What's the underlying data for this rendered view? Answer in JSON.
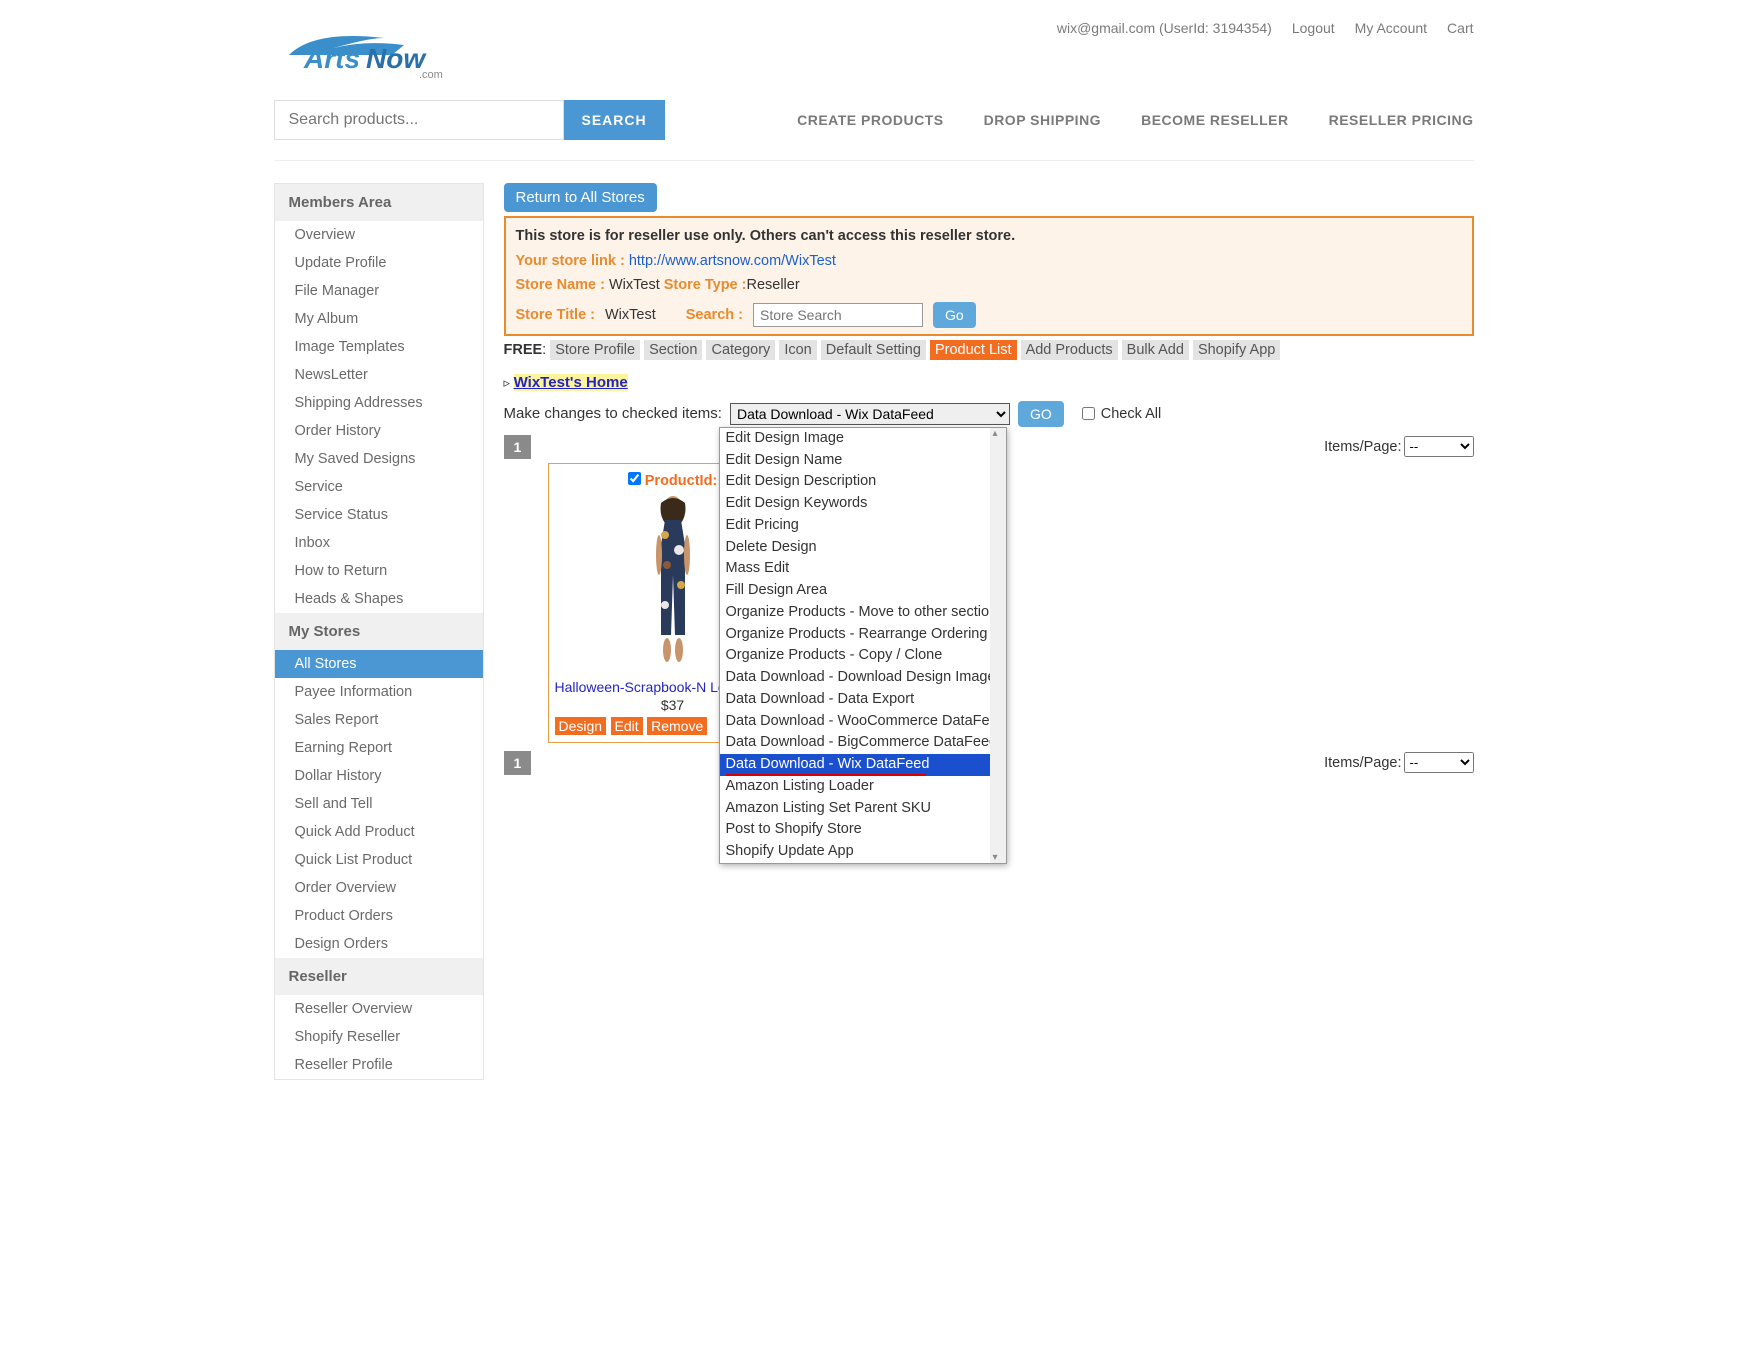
{
  "top": {
    "userinfo": "wix@gmail.com (UserId: 3194354)",
    "logout": "Logout",
    "myaccount": "My Account",
    "cart": "Cart"
  },
  "search": {
    "placeholder": "Search products...",
    "button": "SEARCH"
  },
  "nav": {
    "create": "CREATE PRODUCTS",
    "drop": "DROP SHIPPING",
    "become": "BECOME RESELLER",
    "pricing": "RESELLER PRICING"
  },
  "sidebar": {
    "members_header": "Members Area",
    "members": [
      "Overview",
      "Update Profile",
      "File Manager",
      "My Album",
      "Image Templates",
      "NewsLetter",
      "Shipping Addresses",
      "Order History",
      "My Saved Designs",
      "Service",
      "Service Status",
      "Inbox",
      "How to Return",
      "Heads & Shapes"
    ],
    "stores_header": "My Stores",
    "stores": [
      "All Stores",
      "Payee Information",
      "Sales Report",
      "Earning Report",
      "Dollar History",
      "Sell and Tell",
      "Quick Add Product",
      "Quick List Product",
      "Order Overview",
      "Product Orders",
      "Design Orders"
    ],
    "reseller_header": "Reseller",
    "reseller": [
      "Reseller Overview",
      "Shopify Reseller",
      "Reseller Profile"
    ]
  },
  "main": {
    "return_btn": "Return to All Stores",
    "store": {
      "notice": "This store is for reseller use only. Others can't access this reseller store.",
      "link_label": "Your store link :",
      "link_value": "http://www.artsnow.com/WixTest",
      "name_label": "Store Name :",
      "name_value": "WixTest",
      "type_label": "Store Type :",
      "type_value": "Reseller",
      "title_label": "Store Title :",
      "title_value": "WixTest",
      "search_label": "Search :",
      "search_placeholder": "Store Search",
      "go": "Go"
    },
    "tabs": {
      "free": "FREE",
      "list": [
        "Store Profile",
        "Section",
        "Category",
        "Icon",
        "Default Setting",
        "Product List",
        "Add Products",
        "Bulk Add",
        "Shopify App"
      ]
    },
    "breadcrumb": "WixTest's Home",
    "action": {
      "label": "Make changes to checked items:",
      "selected": "Data Download - Wix DataFeed",
      "go": "GO",
      "checkall": "Check All"
    },
    "pagenum": "1",
    "items_label": "Items/Page:",
    "items_value": "--",
    "product": {
      "id_label": "ProductId:",
      "title": "Halloween-Scrapbook-N Long",
      "price": "$37",
      "design": "Design",
      "edit": "Edit",
      "remove": "Remove"
    },
    "dropdown": [
      "Edit Design Image",
      "Edit Design Name",
      "Edit Design Description",
      "Edit Design Keywords",
      "Edit Pricing",
      "Delete Design",
      "Mass Edit",
      "Fill Design Area",
      "Organize Products - Move to other section",
      "Organize Products - Rearrange Ordering",
      "Organize Products - Copy / Clone",
      "Data Download - Download Design Images",
      "Data Download - Data Export",
      "Data Download - WooCommerce DataFeed",
      "Data Download - BigCommerce DataFeed",
      "Data Download - Wix DataFeed",
      "Amazon Listing Loader",
      "Amazon Listing Set Parent SKU",
      "Post to Shopify Store",
      "Shopify Update App"
    ]
  }
}
